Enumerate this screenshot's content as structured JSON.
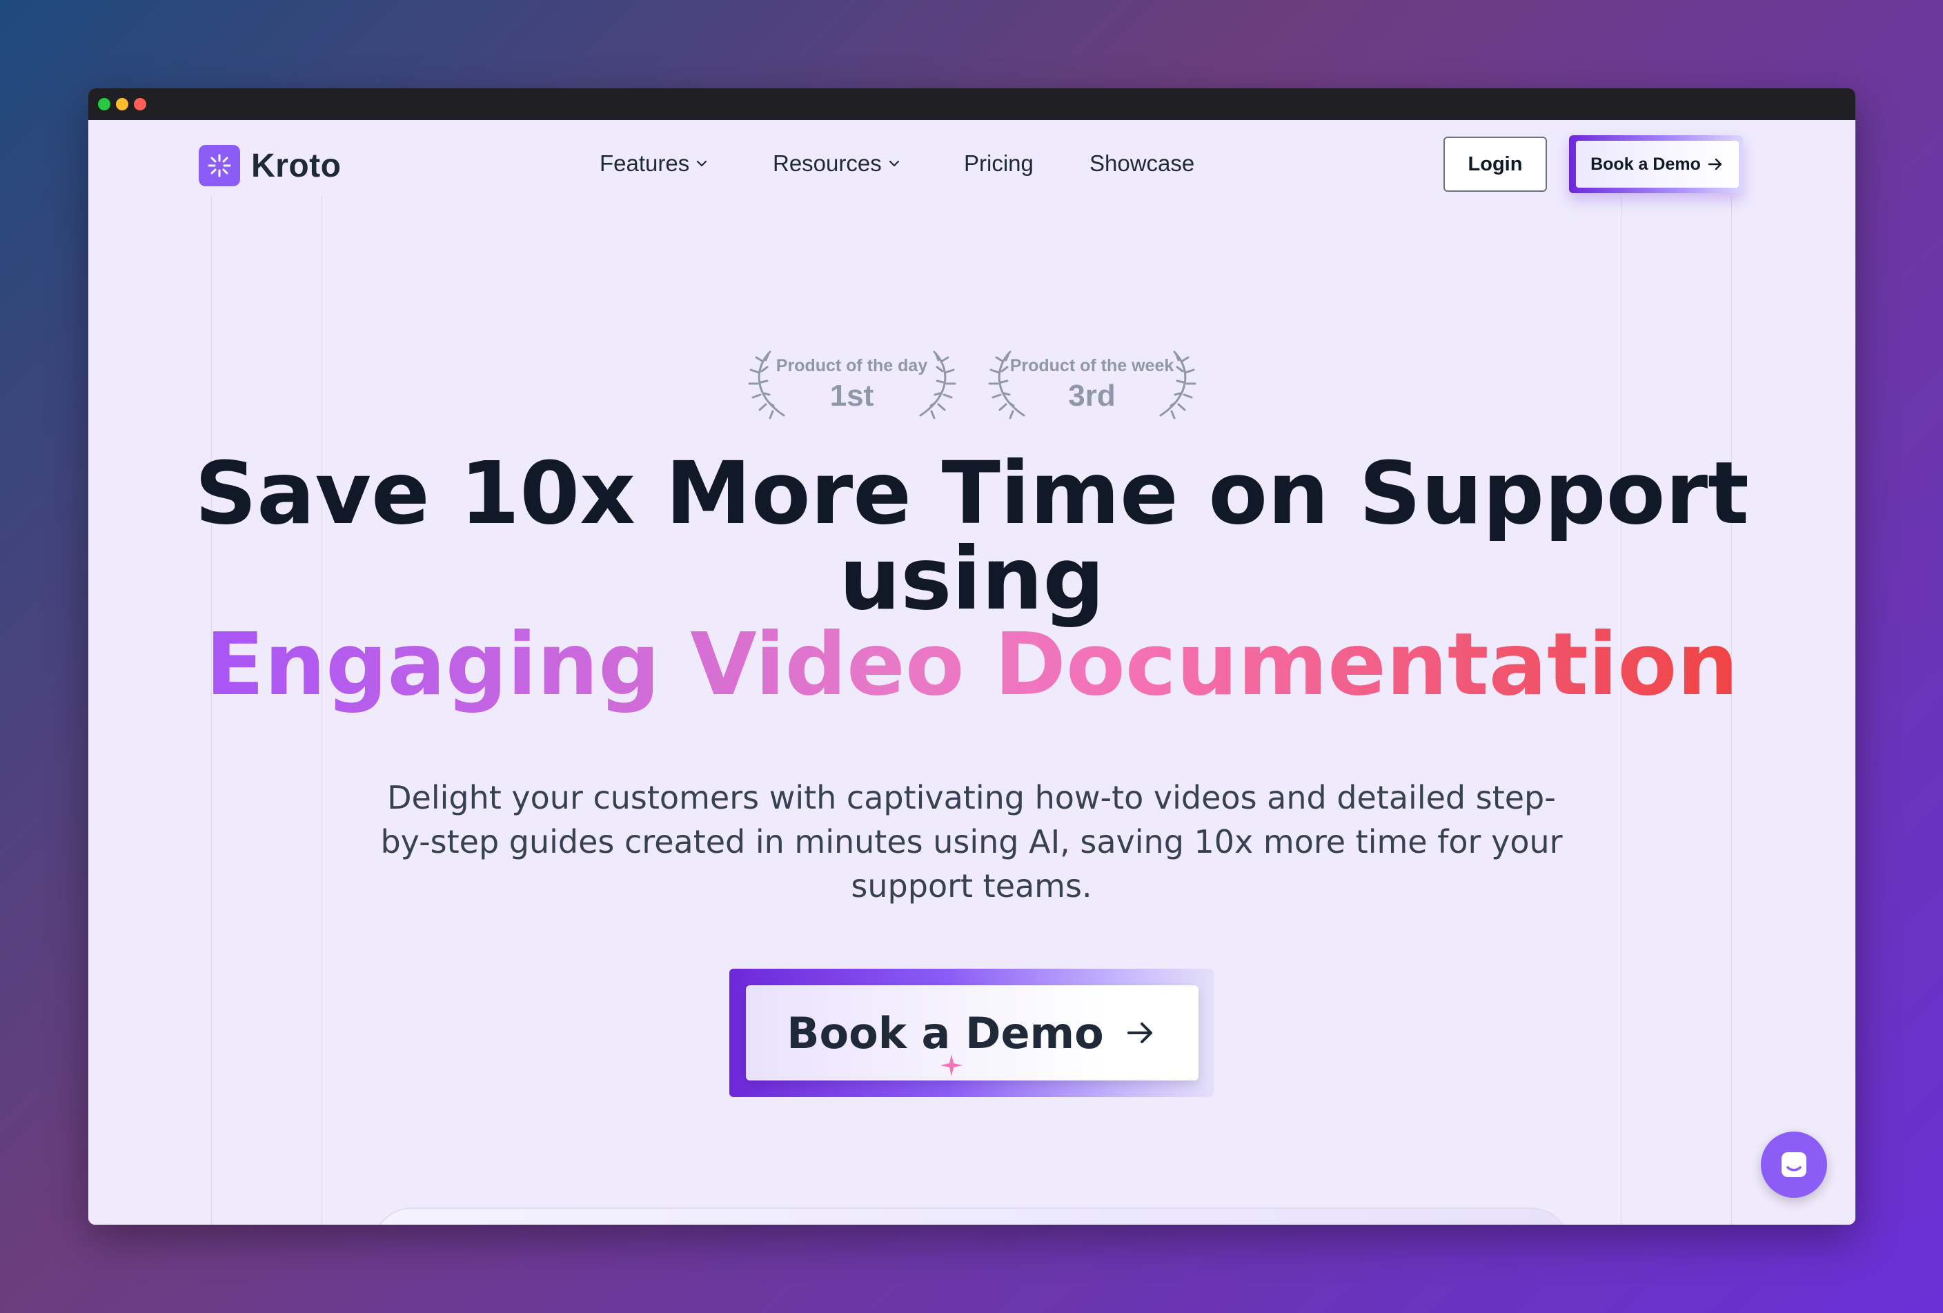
{
  "window": {
    "dots": [
      "#28c840",
      "#febc2e",
      "#ff5f57"
    ]
  },
  "brand": {
    "name": "Kroto",
    "accent": "#8b5cf6"
  },
  "nav": {
    "items": [
      {
        "label": "Features",
        "has_dropdown": true
      },
      {
        "label": "Resources",
        "has_dropdown": true
      },
      {
        "label": "Pricing",
        "has_dropdown": false
      },
      {
        "label": "Showcase",
        "has_dropdown": false
      }
    ],
    "login_label": "Login",
    "demo_label": "Book a Demo"
  },
  "awards": [
    {
      "label": "Product of the day",
      "rank": "1st"
    },
    {
      "label": "Product of the week",
      "rank": "3rd"
    }
  ],
  "hero": {
    "headline_line1": "Save 10x More Time on Support",
    "headline_line2": "using",
    "headline_highlight": "Engaging Video Documentation",
    "subtitle": "Delight your customers with captivating how-to videos and detailed step-by-step guides created in minutes using AI, saving 10x more time for your support teams.",
    "cta_label": "Book a Demo"
  },
  "icons": {
    "logo": "sparkle-logo-icon",
    "dropdown": "chevron-down-icon",
    "arrow": "arrow-right-icon",
    "chat": "chat-icon"
  }
}
